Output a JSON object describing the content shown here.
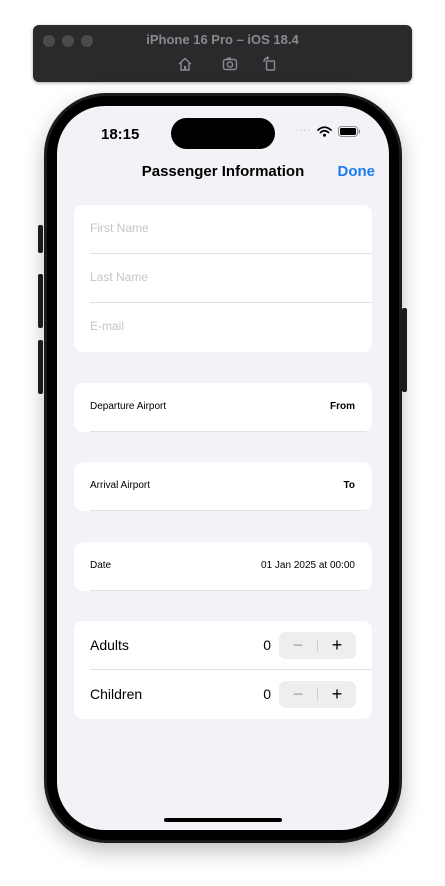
{
  "simulator": {
    "title": "iPhone 16 Pro – iOS 18.4",
    "icons": [
      "home-icon",
      "screenshot-icon",
      "rotate-icon"
    ]
  },
  "status_bar": {
    "time": "18:15",
    "signal_dots": "....",
    "icons": [
      "wifi-icon",
      "battery-icon"
    ]
  },
  "nav": {
    "title": "Passenger Information",
    "done_label": "Done",
    "accent_color": "#1a7cf0"
  },
  "passenger_form": {
    "first_name_placeholder": "First Name",
    "last_name_placeholder": "Last Name",
    "email_placeholder": "E-mail"
  },
  "departure": {
    "label": "Departure Airport",
    "value": "From"
  },
  "arrival": {
    "label": "Arrival Airport",
    "value": "To"
  },
  "date": {
    "label": "Date",
    "value": "01 Jan 2025 at 00:00"
  },
  "travellers": {
    "adults_label": "Adults",
    "adults_count": "0",
    "children_label": "Children",
    "children_count": "0",
    "minus": "−",
    "plus": "+"
  }
}
